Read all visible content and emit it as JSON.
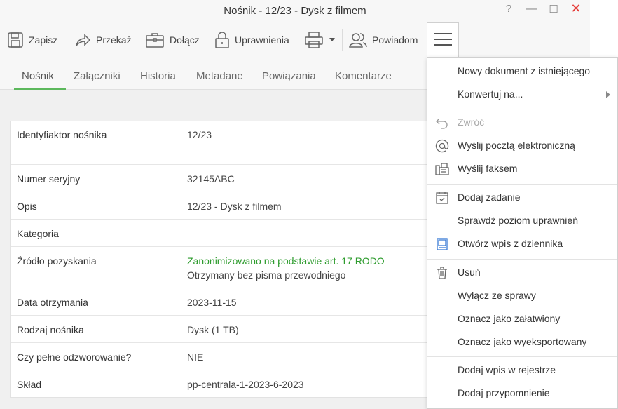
{
  "window": {
    "title": "Nośnik - 12/23 - Dysk z filmem",
    "help": "?",
    "minimize": "—",
    "maximize": "☐",
    "close": "✕"
  },
  "toolbar": {
    "save": "Zapisz",
    "forward": "Przekaż",
    "attach": "Dołącz",
    "permissions": "Uprawnienia",
    "notify": "Powiadom"
  },
  "tabs": [
    "Nośnik",
    "Załączniki",
    "Historia",
    "Metadane",
    "Powiązania",
    "Komentarze"
  ],
  "fields": [
    {
      "label": "Identyfiaktor nośnika",
      "value": "12/23"
    },
    {
      "label": "Numer seryjny",
      "value": "32145ABC"
    },
    {
      "label": "Opis",
      "value": "12/23 - Dysk z filmem"
    },
    {
      "label": "Kategoria",
      "value": ""
    },
    {
      "label": "Źródło pozyskania",
      "value": "Zanonimizowano na podstawie art. 17 RODO",
      "value2": "Otrzymany bez pisma przewodniego"
    },
    {
      "label": "Data otrzymania",
      "value": "2023-11-15"
    },
    {
      "label": "Rodzaj nośnika",
      "value": "Dysk (1 TB)"
    },
    {
      "label": "Czy pełne odzworowanie?",
      "value": "NIE"
    },
    {
      "label": "Skład",
      "value": "pp-centrala-1-2023-6-2023"
    }
  ],
  "menu": {
    "items": [
      {
        "label": "Nowy dokument z istniejącego",
        "icon": ""
      },
      {
        "label": "Konwertuj na...",
        "icon": "submenu-arrow"
      },
      {
        "label": "Zwróć",
        "icon": "undo-icon",
        "disabled": true
      },
      {
        "label": "Wyślij pocztą elektroniczną",
        "icon": "at-icon"
      },
      {
        "label": "Wyślij faksem",
        "icon": "fax-icon"
      },
      {
        "label": "Dodaj zadanie",
        "icon": "calendar-check-icon"
      },
      {
        "label": "Sprawdź poziom uprawnień",
        "icon": ""
      },
      {
        "label": "Otwórz wpis z dziennika",
        "icon": "journal-icon"
      },
      {
        "label": "Usuń",
        "icon": "trash-icon"
      },
      {
        "label": "Wyłącz ze sprawy",
        "icon": ""
      },
      {
        "label": "Oznacz jako załatwiony",
        "icon": ""
      },
      {
        "label": "Oznacz jako wyeksportowany",
        "icon": ""
      },
      {
        "label": "Dodaj wpis w rejestrze",
        "icon": ""
      },
      {
        "label": "Dodaj przypomnienie",
        "icon": ""
      }
    ]
  },
  "colors": {
    "accent": "#5cb85c",
    "anonymized_text": "#2e9c2e",
    "close": "#e53935"
  }
}
